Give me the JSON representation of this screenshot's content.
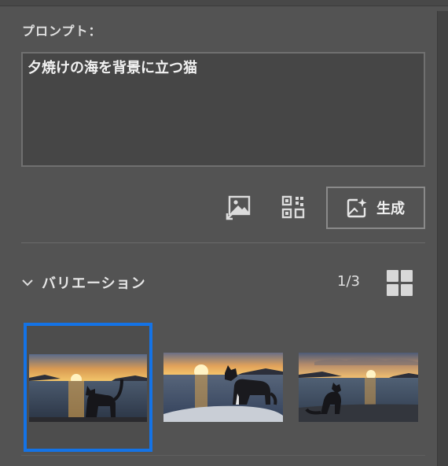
{
  "prompt": {
    "label": "プロンプト：",
    "value": "夕焼けの海を背景に立つ猫"
  },
  "actions": {
    "reference_image_icon": "image-reference-icon",
    "qr_icon": "qr-grid-icon",
    "generate_label": "生成",
    "generate_icon": "sparkle-image-icon"
  },
  "variations": {
    "title": "バリエーション",
    "counter": "1/3",
    "selected_index": 0,
    "items": [
      {
        "name": "variation-1"
      },
      {
        "name": "variation-2"
      },
      {
        "name": "variation-3"
      }
    ]
  },
  "colors": {
    "panel_bg": "#535353",
    "selection": "#1473e6",
    "input_bg": "#464646"
  }
}
